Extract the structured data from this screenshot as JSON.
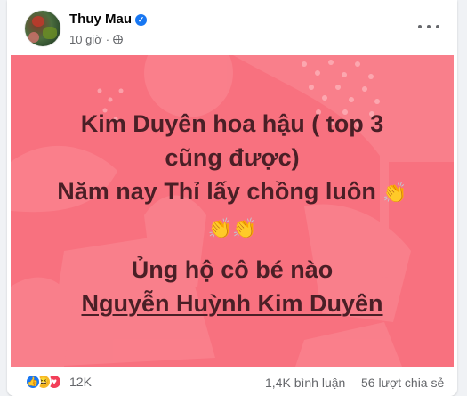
{
  "post": {
    "author": "Thuy Mau",
    "time": "10 giờ",
    "separator": "·",
    "text_lines": [
      "Kim Duyên hoa hậu ( top 3",
      "cũng được)",
      "Năm nay Thỉ lấy chồng luôn"
    ],
    "line4": "Ủng hộ cô bé nào",
    "line5": "Nguyễn Huỳnh Kim Duyên",
    "background_color": "#f8717f",
    "text_color": "#4a1f26"
  },
  "icons": {
    "verified": "verified-badge-icon",
    "audience": "globe-icon",
    "more": "more-options-icon",
    "clap": "clapping-hands-emoji"
  },
  "stats": {
    "reaction_count": "12K",
    "comments": "1,4K bình luận",
    "shares": "56 lượt chia sẻ"
  }
}
